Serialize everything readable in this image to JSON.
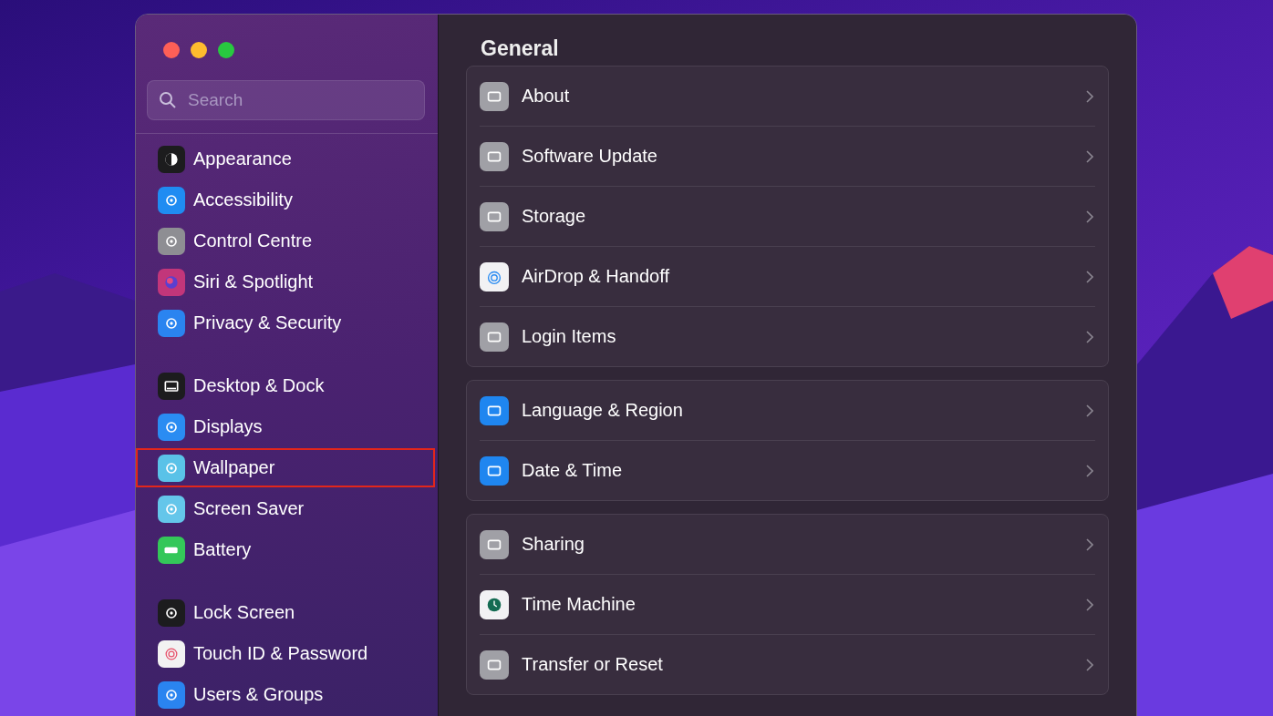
{
  "window": {
    "search": {
      "placeholder": "Search"
    },
    "title": "General"
  },
  "sidebar": {
    "groups": [
      {
        "items": [
          {
            "label": "Appearance",
            "color": "#1c1c1e",
            "highlighted": false
          },
          {
            "label": "Accessibility",
            "color": "#1f8cf2",
            "highlighted": false
          },
          {
            "label": "Control Centre",
            "color": "#8e8e93",
            "highlighted": false
          },
          {
            "label": "Siri & Spotlight",
            "color": "#c2367a",
            "highlighted": false
          },
          {
            "label": "Privacy & Security",
            "color": "#2a84f0",
            "highlighted": false
          }
        ]
      },
      {
        "items": [
          {
            "label": "Desktop & Dock",
            "color": "#1c1c1e",
            "highlighted": false
          },
          {
            "label": "Displays",
            "color": "#2a8cf2",
            "highlighted": false
          },
          {
            "label": "Wallpaper",
            "color": "#5ac2e8",
            "highlighted": true
          },
          {
            "label": "Screen Saver",
            "color": "#64c6ea",
            "highlighted": false
          },
          {
            "label": "Battery",
            "color": "#34c759",
            "highlighted": false
          }
        ]
      },
      {
        "items": [
          {
            "label": "Lock Screen",
            "color": "#1c1c1e",
            "highlighted": false
          },
          {
            "label": "Touch ID & Password",
            "color": "#f2f2f2",
            "highlighted": false
          },
          {
            "label": "Users & Groups",
            "color": "#2a84f0",
            "highlighted": false
          }
        ]
      }
    ]
  },
  "sections": [
    {
      "rows": [
        {
          "label": "About",
          "color": "#a0a0a6"
        },
        {
          "label": "Software Update",
          "color": "#a0a0a6"
        },
        {
          "label": "Storage",
          "color": "#a0a0a6"
        },
        {
          "label": "AirDrop & Handoff",
          "color": "#f2f2f4"
        },
        {
          "label": "Login Items",
          "color": "#a0a0a6"
        }
      ]
    },
    {
      "rows": [
        {
          "label": "Language & Region",
          "color": "#1f86f0"
        },
        {
          "label": "Date & Time",
          "color": "#1f86f0"
        }
      ]
    },
    {
      "rows": [
        {
          "label": "Sharing",
          "color": "#a0a0a6"
        },
        {
          "label": "Time Machine",
          "color": "#f2f2f4"
        },
        {
          "label": "Transfer or Reset",
          "color": "#a0a0a6"
        }
      ]
    }
  ]
}
